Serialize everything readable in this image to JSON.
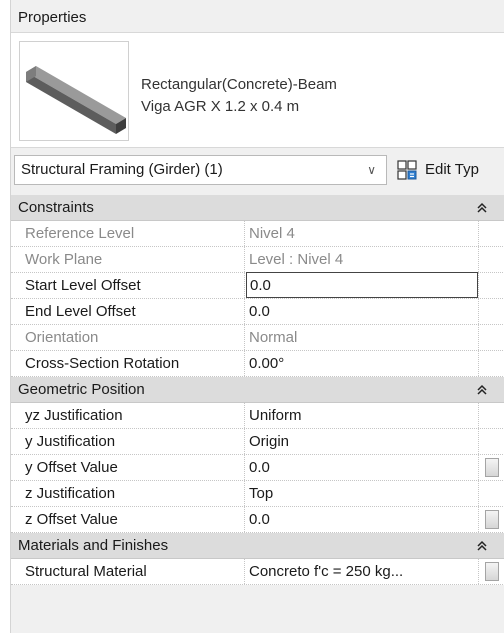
{
  "panel": {
    "title": "Properties"
  },
  "type_header": {
    "family": "Rectangular(Concrete)-Beam",
    "type": "Viga AGR X 1.2 x 0.4 m",
    "icon": "beam-thumbnail-icon"
  },
  "selector": {
    "value": "Structural Framing (Girder) (1)",
    "edit_type_label": "Edit Typ"
  },
  "sections": {
    "constraints": "Constraints",
    "geometric": "Geometric Position",
    "materials": "Materials and Finishes"
  },
  "rows": {
    "reference_level": {
      "name": "Reference Level",
      "value": "Nivel 4"
    },
    "work_plane": {
      "name": "Work Plane",
      "value": "Level : Nivel 4"
    },
    "start_offset": {
      "name": "Start Level Offset",
      "value": "0.0"
    },
    "end_offset": {
      "name": "End Level Offset",
      "value": "0.0"
    },
    "orientation": {
      "name": "Orientation",
      "value": "Normal"
    },
    "cs_rotation": {
      "name": "Cross-Section Rotation",
      "value": "0.00°"
    },
    "yz_just": {
      "name": "yz Justification",
      "value": "Uniform"
    },
    "y_just": {
      "name": "y Justification",
      "value": "Origin"
    },
    "y_offset": {
      "name": "y Offset Value",
      "value": "0.0"
    },
    "z_just": {
      "name": "z Justification",
      "value": "Top"
    },
    "z_offset": {
      "name": "z Offset Value",
      "value": "0.0"
    },
    "material": {
      "name": "Structural Material",
      "value": "Concreto f'c = 250 kg..."
    }
  }
}
